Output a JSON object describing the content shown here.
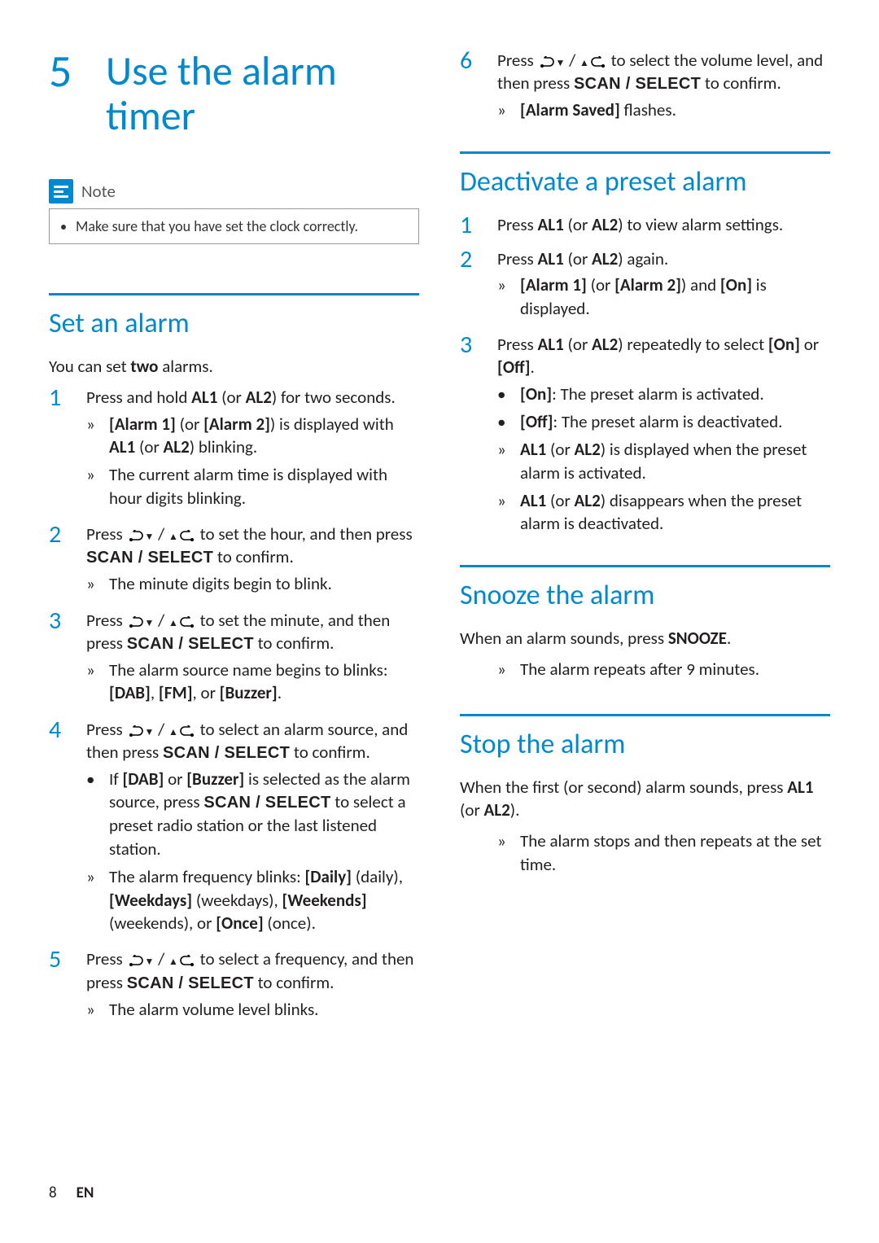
{
  "chapter": {
    "num": "5",
    "title": "Use the alarm timer"
  },
  "note": {
    "label": "Note",
    "bullet0": "Make sure that you have set the clock correctly."
  },
  "sect_set": {
    "title": "Set an alarm",
    "intro_a": "You can set ",
    "intro_b": "two",
    "intro_c": " alarms.",
    "s1_a": "Press and hold ",
    "s1_b": "AL1",
    "s1_c": " (or ",
    "s1_d": "AL2",
    "s1_e": ") for two seconds.",
    "s1_r1_a": "[Alarm 1]",
    "s1_r1_b": " (or ",
    "s1_r1_c": "[Alarm 2]",
    "s1_r1_d": ") is displayed with ",
    "s1_r1_e": "AL1",
    "s1_r1_f": " (or ",
    "s1_r1_g": "AL2",
    "s1_r1_h": ") blinking.",
    "s1_r2": "The current alarm time is displayed with hour digits blinking.",
    "s2_a": "Press ",
    "s2_b": " to set the hour, and then press ",
    "s2_c": " to confirm.",
    "s2_r1": "The minute digits begin to blink.",
    "s3_a": "Press ",
    "s3_b": " to set the minute, and then press ",
    "s3_c": " to confirm.",
    "s3_r1_a": "The alarm source name begins to blinks: ",
    "s3_r1_b": "[DAB]",
    "s3_r1_c": ", ",
    "s3_r1_d": "[FM]",
    "s3_r1_e": ", or ",
    "s3_r1_f": "[Buzzer]",
    "s3_r1_g": ".",
    "s4_a": "Press ",
    "s4_b": " to select an alarm source, and then press ",
    "s4_c": " to confirm.",
    "s4_b1_a": "If ",
    "s4_b1_b": "[DAB]",
    "s4_b1_c": " or ",
    "s4_b1_d": "[Buzzer]",
    "s4_b1_e": " is selected as the alarm source, press ",
    "s4_b1_f": " to select a preset radio station or the last listened station.",
    "s4_r1_a": "The alarm frequency blinks: ",
    "s4_r1_b": "[Daily]",
    "s4_r1_c": " (daily), ",
    "s4_r1_d": "[Weekdays]",
    "s4_r1_e": " (weekdays), ",
    "s4_r1_f": "[Weekends]",
    "s4_r1_g": " (weekends), or ",
    "s4_r1_h": "[Once]",
    "s4_r1_i": " (once).",
    "s5_a": "Press ",
    "s5_b": " to select a frequency, and then press ",
    "s5_c": " to confirm.",
    "s5_r1": "The alarm volume level blinks.",
    "s6_a": "Press ",
    "s6_b": " to select the volume level, and then press ",
    "s6_c": " to confirm.",
    "s6_r1_a": "[Alarm Saved]",
    "s6_r1_b": " flashes."
  },
  "scan_label": "SCAN / SELECT",
  "icons_sep": " / ",
  "sect_deact": {
    "title": "Deactivate a preset alarm",
    "s1_a": "Press ",
    "s1_b": "AL1",
    "s1_c": " (or ",
    "s1_d": "AL2",
    "s1_e": ") to view alarm settings.",
    "s2_a": "Press ",
    "s2_b": "AL1",
    "s2_c": " (or ",
    "s2_d": "AL2",
    "s2_e": ") again.",
    "s2_r1_a": "[Alarm 1]",
    "s2_r1_b": " (or ",
    "s2_r1_c": "[Alarm 2]",
    "s2_r1_d": ") and ",
    "s2_r1_e": "[On]",
    "s2_r1_f": " is displayed.",
    "s3_a": "Press ",
    "s3_b": "AL1",
    "s3_c": " (or ",
    "s3_d": "AL2",
    "s3_e": ") repeatedly to select ",
    "s3_f": "[On]",
    "s3_g": " or ",
    "s3_h": "[Off]",
    "s3_i": ".",
    "s3_b1_a": "[On]",
    "s3_b1_b": ": The preset alarm is activated.",
    "s3_b2_a": "[Off]",
    "s3_b2_b": ": The preset alarm is deactivated.",
    "s3_r1_a": "AL1",
    "s3_r1_b": " (or ",
    "s3_r1_c": "AL2",
    "s3_r1_d": ") is displayed when the preset alarm is activated.",
    "s3_r2_a": "AL1",
    "s3_r2_b": " (or ",
    "s3_r2_c": "AL2",
    "s3_r2_d": ") disappears when the preset alarm is deactivated."
  },
  "sect_snooze": {
    "title": "Snooze the alarm",
    "p_a": "When an alarm sounds, press ",
    "p_b": "SNOOZE",
    "p_c": ".",
    "r1": "The alarm repeats after 9 minutes."
  },
  "sect_stop": {
    "title": "Stop the alarm",
    "p_a": "When the first (or second) alarm sounds, press ",
    "p_b": "AL1",
    "p_c": " (or ",
    "p_d": "AL2",
    "p_e": ").",
    "r1": "The alarm stops and then repeats at the set time."
  },
  "footer": {
    "page": "8",
    "lang": "EN"
  }
}
